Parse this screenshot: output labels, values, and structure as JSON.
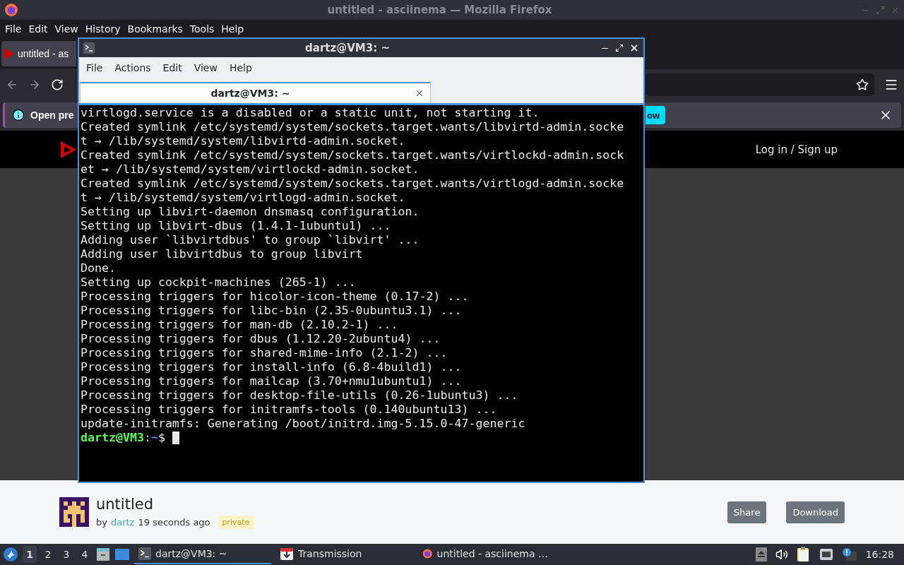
{
  "firefox": {
    "title": "untitled - asciinema — Mozilla Firefox",
    "menu": [
      "File",
      "Edit",
      "View",
      "History",
      "Bookmarks",
      "Tools",
      "Help"
    ],
    "tab": {
      "label": "untitled - as",
      "selected": true
    },
    "notification": {
      "text": "Open pre",
      "button": "ow"
    },
    "site": {
      "auth_link": "Log in / Sign up"
    },
    "recording": {
      "title": "untitled",
      "by": "by",
      "author": "dartz",
      "age": "19 seconds ago",
      "badge": "private",
      "buttons": [
        "Share",
        "Download"
      ]
    }
  },
  "terminal": {
    "title": "dartz@VM3: ~",
    "menu": [
      "File",
      "Actions",
      "Edit",
      "View",
      "Help"
    ],
    "tab": {
      "label": "dartz@VM3: ~",
      "selected": true
    },
    "lines": [
      "virtlogd.service is a disabled or a static unit, not starting it.",
      "Created symlink /etc/systemd/system/sockets.target.wants/libvirtd-admin.socke",
      "t → /lib/systemd/system/libvirtd-admin.socket.",
      "Created symlink /etc/systemd/system/sockets.target.wants/virtlockd-admin.sock",
      "et → /lib/systemd/system/virtlockd-admin.socket.",
      "Created symlink /etc/systemd/system/sockets.target.wants/virtlogd-admin.socke",
      "t → /lib/systemd/system/virtlogd-admin.socket.",
      "Setting up libvirt-daemon dnsmasq configuration.",
      "Setting up libvirt-dbus (1.4.1-1ubuntu1) ...",
      "Adding user `libvirtdbus' to group `libvirt' ...",
      "Adding user libvirtdbus to group libvirt",
      "Done.",
      "Setting up cockpit-machines (265-1) ...",
      "Processing triggers for hicolor-icon-theme (0.17-2) ...",
      "Processing triggers for libc-bin (2.35-0ubuntu3.1) ...",
      "Processing triggers for man-db (2.10.2-1) ...",
      "Processing triggers for dbus (1.12.20-2ubuntu4) ...",
      "Processing triggers for shared-mime-info (2.1-2) ...",
      "Processing triggers for install-info (6.8-4build1) ...",
      "Processing triggers for mailcap (3.70+nmu1ubuntu1) ...",
      "Processing triggers for desktop-file-utils (0.26-1ubuntu3) ...",
      "Processing triggers for initramfs-tools (0.140ubuntu13) ...",
      "update-initramfs: Generating /boot/initrd.img-5.15.0-47-generic"
    ],
    "prompt": {
      "user_host": "dartz@VM3",
      "separator": ":",
      "path": "~",
      "symbol": "$"
    }
  },
  "taskbar": {
    "workspaces": [
      {
        "label": "1",
        "selected": true
      },
      {
        "label": "2",
        "selected": false
      },
      {
        "label": "3",
        "selected": false
      },
      {
        "label": "4",
        "selected": false
      }
    ],
    "tasks": [
      {
        "kind": "terminal",
        "label": "dartz@VM3: ~",
        "selected": true
      },
      {
        "kind": "transmission",
        "label": "Transmission",
        "selected": false
      },
      {
        "kind": "firefox",
        "label": "untitled - asciinema …",
        "selected": false
      }
    ],
    "clock": "16:28"
  }
}
